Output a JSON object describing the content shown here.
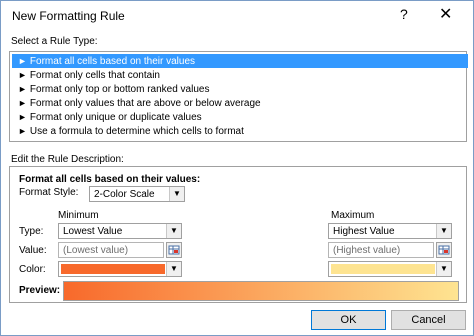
{
  "dialog": {
    "title": "New Formatting Rule",
    "help_glyph": "?",
    "close_glyph": "✕"
  },
  "rule_type": {
    "label": "Select a Rule Type:",
    "items": [
      "Format all cells based on their values",
      "Format only cells that contain",
      "Format only top or bottom ranked values",
      "Format only values that are above or below average",
      "Format only unique or duplicate values",
      "Use a formula to determine which cells to format"
    ],
    "selected_index": 0,
    "arrow_glyph": "►"
  },
  "description": {
    "label": "Edit the Rule Description:",
    "heading": "Format all cells based on their values:",
    "format_style_label": "Format Style:",
    "format_style_value": "2-Color Scale",
    "type_label": "Type:",
    "value_label": "Value:",
    "color_label": "Color:",
    "minimum": {
      "header": "Minimum",
      "type": "Lowest Value",
      "value_placeholder": "(Lowest value)",
      "color": "#f8692b"
    },
    "maximum": {
      "header": "Maximum",
      "type": "Highest Value",
      "value_placeholder": "(Highest value)",
      "color": "#fee491"
    },
    "preview_label": "Preview:"
  },
  "buttons": {
    "ok": "OK",
    "cancel": "Cancel"
  },
  "colors": {
    "selection": "#3399ff",
    "min_color": "#f8692b",
    "max_color": "#fee491"
  }
}
